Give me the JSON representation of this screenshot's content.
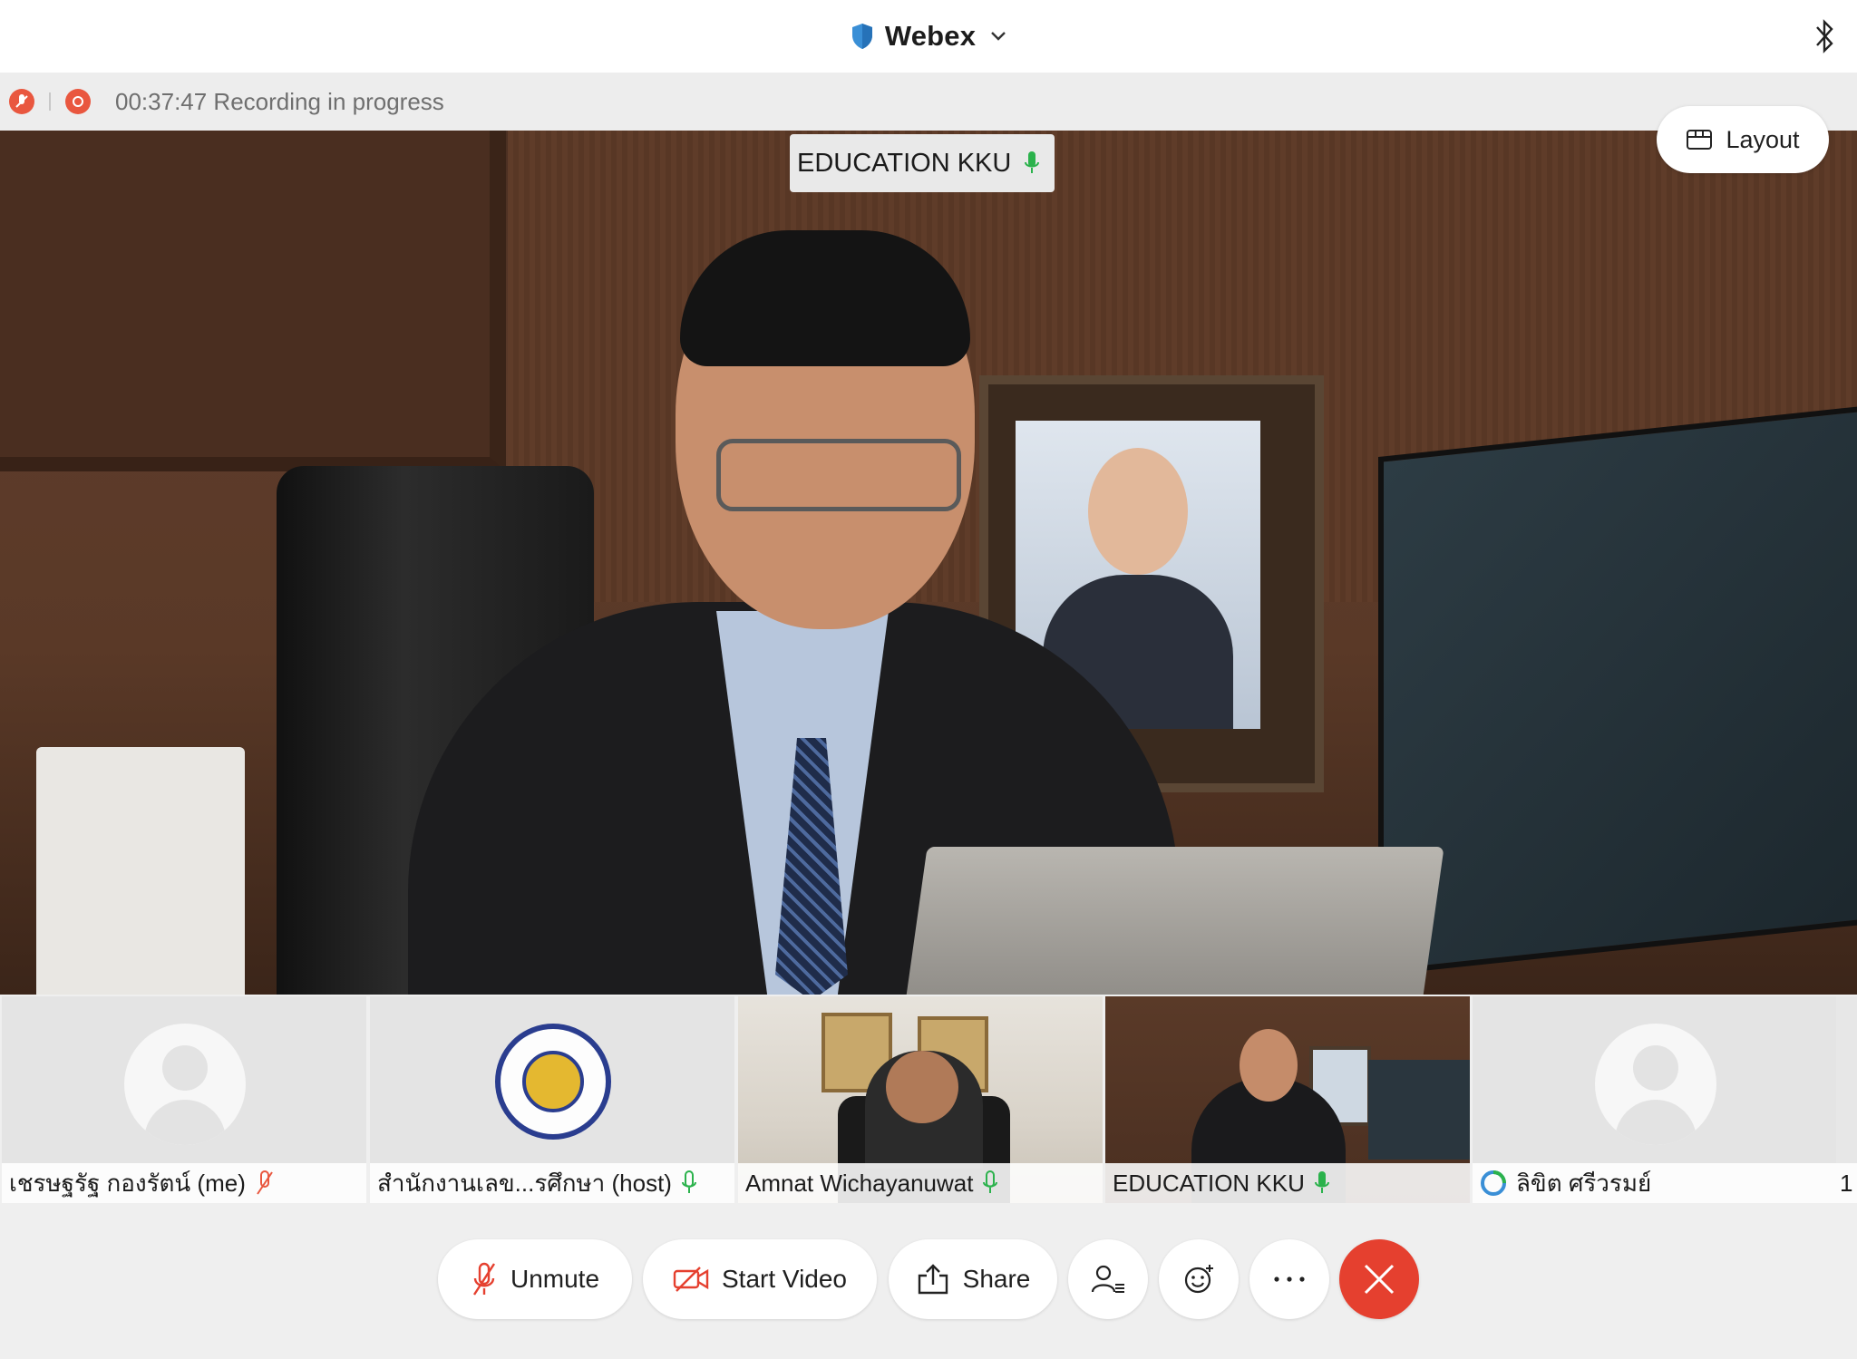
{
  "app": {
    "title": "Webex"
  },
  "recording": {
    "text": "00:37:47 Recording in progress"
  },
  "stage": {
    "active_speaker": "EDUCATION KKU",
    "layout_label": "Layout"
  },
  "participants": [
    {
      "name": "เชรษฐรัฐ กองรัตน์ (me)",
      "mic": "muted"
    },
    {
      "name": "สำนักงานเลข...รศึกษา (host)",
      "mic": "on"
    },
    {
      "name": "Amnat Wichayanuwat",
      "mic": "on"
    },
    {
      "name": "EDUCATION KKU",
      "mic": "active"
    },
    {
      "name": "ลิขิต ศรีวรมย์",
      "mic": "none"
    },
    {
      "name": "1",
      "mic": "none"
    }
  ],
  "controls": {
    "unmute": "Unmute",
    "start_video": "Start Video",
    "share": "Share"
  },
  "colors": {
    "accent_red": "#e5402f",
    "mic_green": "#2bb24c",
    "recording_red": "#e9573f"
  }
}
